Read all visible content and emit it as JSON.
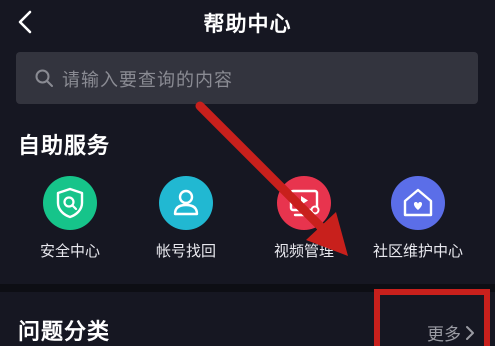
{
  "header": {
    "title": "帮助中心",
    "back_icon": "chevron-left-icon"
  },
  "search": {
    "placeholder": "请输入要查询的内容",
    "icon": "search-icon"
  },
  "self_service": {
    "title": "自助服务",
    "items": [
      {
        "label": "安全中心",
        "icon": "shield-search-icon",
        "color": "#16c48a"
      },
      {
        "label": "帐号找回",
        "icon": "user-icon",
        "color": "#21b8d2"
      },
      {
        "label": "视频管理",
        "icon": "video-settings-icon",
        "color": "#e8344e"
      },
      {
        "label": "社区维护中心",
        "icon": "home-heart-icon",
        "color": "#5b6ee8"
      }
    ]
  },
  "categories": {
    "title": "问题分类",
    "more_label": "更多"
  },
  "annotation": {
    "color": "#c8201c"
  }
}
